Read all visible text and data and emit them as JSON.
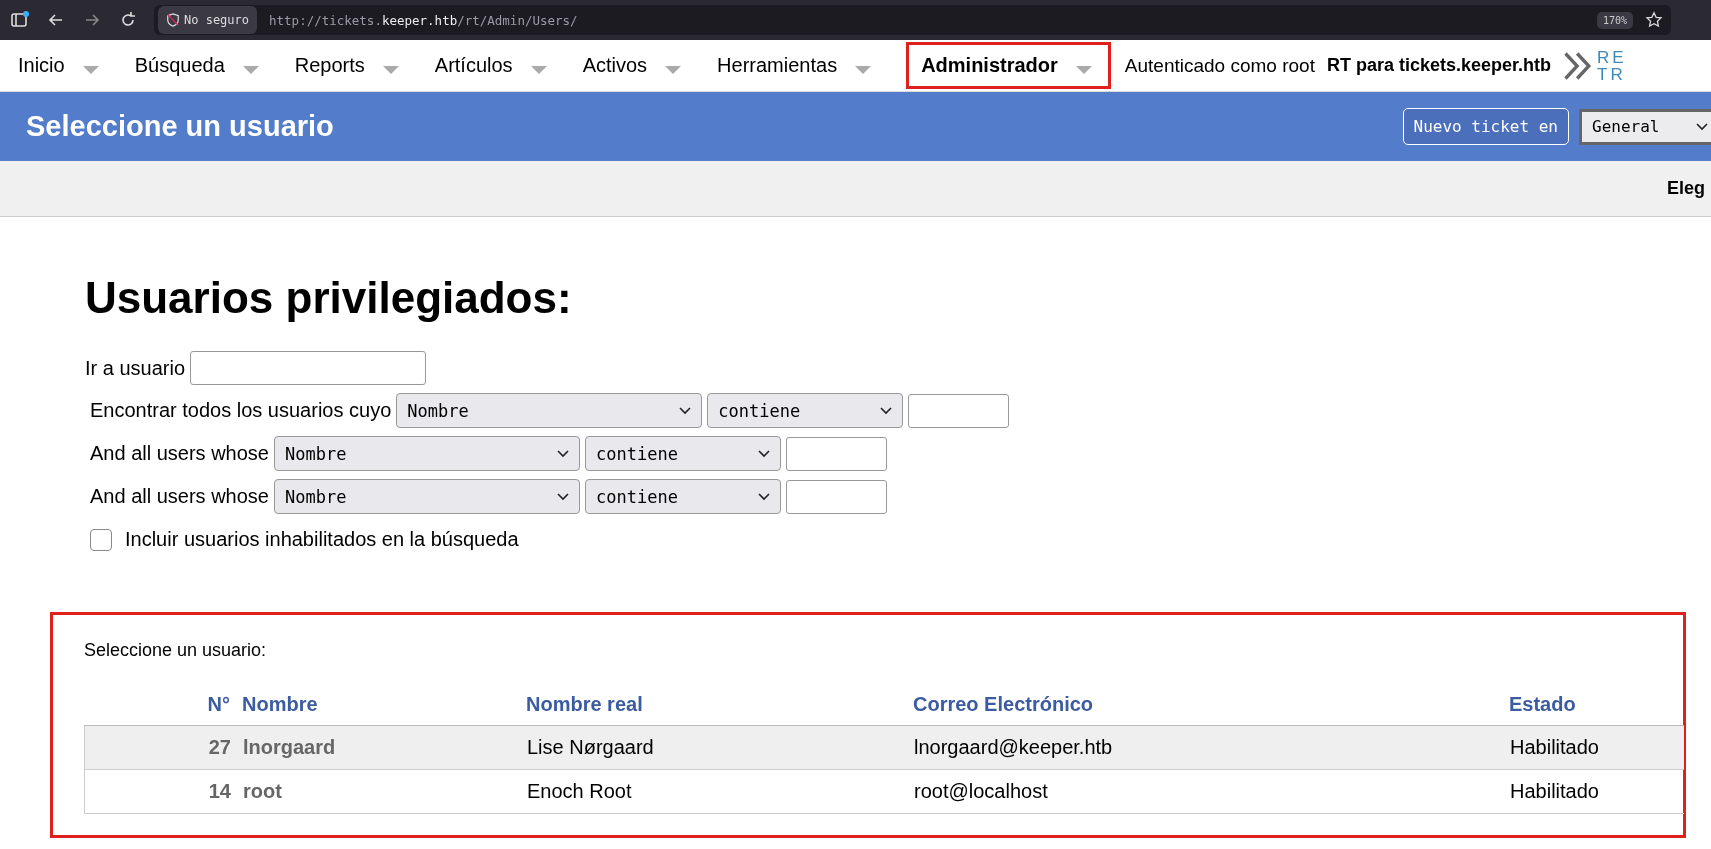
{
  "browser": {
    "security_label": "No seguro",
    "url": "http://tickets.**keeper.htb**/rt/Admin/Users/",
    "zoom": "170%"
  },
  "nav": {
    "items": [
      {
        "label": "Inicio",
        "selected": false
      },
      {
        "label": "Búsqueda",
        "selected": false
      },
      {
        "label": "Reports",
        "selected": false
      },
      {
        "label": "Artículos",
        "selected": false
      },
      {
        "label": "Activos",
        "selected": false
      },
      {
        "label": "Herramientas",
        "selected": false
      },
      {
        "label": "Administrador",
        "selected": true
      }
    ],
    "user_label": "Autenticado como root",
    "site_title": "RT para tickets.keeper.htb",
    "logo_lines": [
      "RE",
      "TR"
    ]
  },
  "header": {
    "title": "Seleccione un usuario",
    "new_ticket_button": "Nuevo ticket en",
    "queue_select": "General"
  },
  "subbar": {
    "text": "Eleg"
  },
  "heading": "Usuarios privilegiados:",
  "goto": {
    "label": "Ir a usuario"
  },
  "filters": [
    {
      "label": "Encontrar todos los usuarios cuyo",
      "field": "Nombre",
      "operator": "contiene"
    },
    {
      "label": "And all users whose",
      "field": "Nombre",
      "operator": "contiene"
    },
    {
      "label": "And all users whose",
      "field": "Nombre",
      "operator": "contiene"
    }
  ],
  "include_disabled": {
    "label": "Incluir usuarios inhabilitados en la búsqueda",
    "checked": false
  },
  "results": {
    "caption": "Seleccione un usuario:",
    "columns": [
      "N°",
      "Nombre",
      "Nombre real",
      "Correo Electrónico",
      "Estado"
    ],
    "rows": [
      {
        "id": "27",
        "name": "lnorgaard",
        "real_name": "Lise Nørgaard",
        "email": "lnorgaard@keeper.htb",
        "status": "Habilitado"
      },
      {
        "id": "14",
        "name": "root",
        "real_name": "Enoch Root",
        "email": "root@localhost",
        "status": "Habilitado"
      }
    ]
  }
}
